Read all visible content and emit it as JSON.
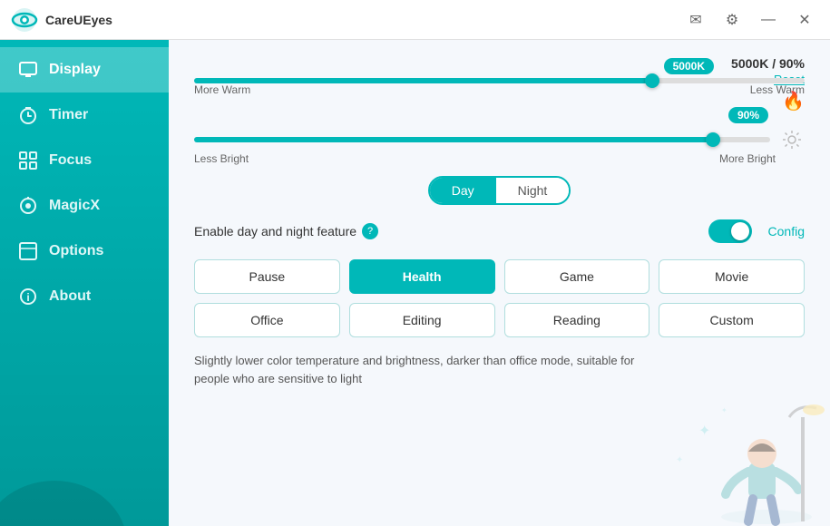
{
  "app": {
    "title": "CareUEyes"
  },
  "titlebar": {
    "email_icon": "✉",
    "settings_icon": "⚙",
    "minimize_icon": "—",
    "close_icon": "✕"
  },
  "sidebar": {
    "items": [
      {
        "id": "display",
        "label": "Display",
        "icon": "🖥",
        "active": true
      },
      {
        "id": "timer",
        "label": "Timer",
        "icon": "🕐",
        "active": false
      },
      {
        "id": "focus",
        "label": "Focus",
        "icon": "⊞",
        "active": false
      },
      {
        "id": "magicx",
        "label": "MagicX",
        "icon": "✦",
        "active": false
      },
      {
        "id": "options",
        "label": "Options",
        "icon": "⬚",
        "active": false
      },
      {
        "id": "about",
        "label": "About",
        "icon": "ℹ",
        "active": false
      }
    ]
  },
  "display": {
    "temp_value": "5000K",
    "brightness_value": "90%",
    "temp_display": "5000K / 90%",
    "reset_label": "Reset",
    "more_warm": "More Warm",
    "less_warm": "Less Warm",
    "less_bright": "Less Bright",
    "more_bright": "More Bright",
    "temp_slider_pct": 75,
    "brightness_slider_pct": 90,
    "day_label": "Day",
    "night_label": "Night",
    "active_day_night": "Day",
    "enable_label": "Enable day and night feature",
    "config_label": "Config",
    "presets": [
      {
        "id": "pause",
        "label": "Pause",
        "active": false
      },
      {
        "id": "health",
        "label": "Health",
        "active": true
      },
      {
        "id": "game",
        "label": "Game",
        "active": false
      },
      {
        "id": "movie",
        "label": "Movie",
        "active": false
      },
      {
        "id": "office",
        "label": "Office",
        "active": false
      },
      {
        "id": "editing",
        "label": "Editing",
        "active": false
      },
      {
        "id": "reading",
        "label": "Reading",
        "active": false
      },
      {
        "id": "custom",
        "label": "Custom",
        "active": false
      }
    ],
    "preset_description": "Slightly lower color temperature and brightness, darker than office mode, suitable for people who are sensitive to light"
  }
}
